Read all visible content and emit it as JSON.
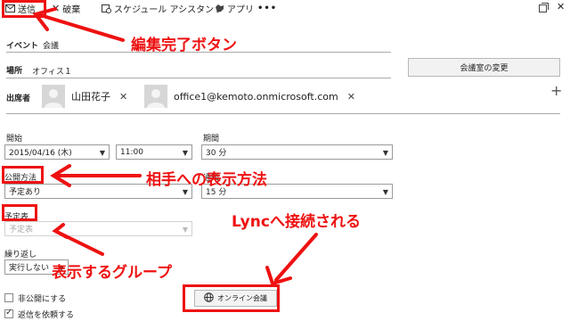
{
  "toolbar": {
    "send_label": "送信",
    "discard_label": "破棄",
    "scheduling_label": "スケジュール アシスタント",
    "apps_label": "アプリ",
    "more_label": "•••"
  },
  "event": {
    "label": "イベント",
    "value": "会議"
  },
  "location": {
    "label": "場所",
    "value": "オフィス１",
    "change_room_label": "会議室の変更"
  },
  "attendees": {
    "label": "出席者",
    "people": [
      {
        "name": "山田花子"
      },
      {
        "name": "office1@kemoto.onmicrosoft.com"
      }
    ]
  },
  "start": {
    "label": "開始",
    "date": "2015/04/16 (木)",
    "time": "11:00"
  },
  "duration": {
    "label": "期間",
    "value": "30 分"
  },
  "show_as": {
    "label": "公開方法",
    "value": "予定あり"
  },
  "reminder": {
    "label_partial": "通知",
    "value": "15 分"
  },
  "calendar": {
    "label": "予定表",
    "value": "予定表"
  },
  "repeat": {
    "label": "繰り返し",
    "value": "実行しない"
  },
  "options": {
    "private_label": "非公開にする",
    "private_checked": false,
    "request_response_label": "返信を依頼する",
    "request_response_checked": true
  },
  "online_meeting": {
    "label": "オンライン会議"
  },
  "annotations": {
    "edit_complete": "編集完了ボタン",
    "show_as_desc": "相手への表示方法",
    "lync_connect": "Lyncへ接続される",
    "display_group": "表示するグループ"
  },
  "colors": {
    "annotation": "#ee1111"
  }
}
